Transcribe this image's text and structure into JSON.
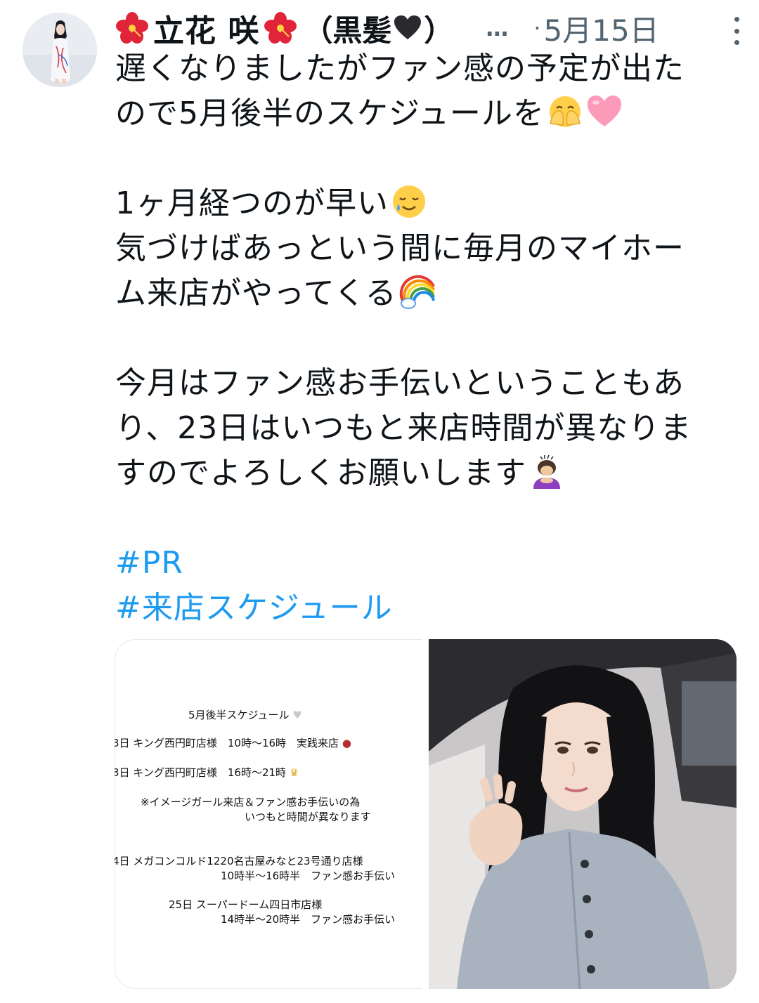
{
  "author": {
    "display_name": "立花 咲",
    "paren_name": "（黒髪",
    "paren_close": "）",
    "ellipsis": "…",
    "separator": "·",
    "date": "5月15日"
  },
  "body": {
    "lines": [
      "遅くなりましたがファン感の予定が出た",
      "ので5月後半のスケジュールを",
      "1ヶ月経つのが早い",
      "気づけばあっという間に毎月のマイホー",
      "ム来店がやってくる",
      "今月はファン感お手伝いということもあ",
      "り、23日はいつもと来店時間が異なりま",
      "すのでよろしくお願いします"
    ],
    "hashtags": [
      "#PR",
      "#来店スケジュール"
    ]
  },
  "icons": {
    "name_left": "hibiscus-icon",
    "name_right": "hibiscus-icon",
    "name_heart": "black-heart-icon",
    "emoji_1": "hands-over-mouth-emoji",
    "emoji_2": "pink-heart-emoji",
    "emoji_3": "smiling-face-with-tear-emoji",
    "emoji_4": "rainbow-emoji",
    "emoji_5": "person-bowing-emoji",
    "more": "more-vertical-icon"
  },
  "schedule_image": {
    "title": "5月後半スケジュール",
    "rows": [
      "3日 キング西円町店様　10時〜16時　実践来店",
      "3日 キング西円町店様　16時〜21時",
      "※イメージガール来店＆ファン感お手伝いの為",
      "いつもと時間が異なります",
      "4日 メガコンコルド1220名古屋みなと23号通り店様",
      "10時半〜16時半　ファン感お手伝い",
      "25日 スーパードーム四日市店様",
      "14時半〜20時半　ファン感お手伝い"
    ]
  },
  "colors": {
    "text": "#0f1419",
    "secondary": "#536471",
    "link": "#1d9bf0"
  }
}
